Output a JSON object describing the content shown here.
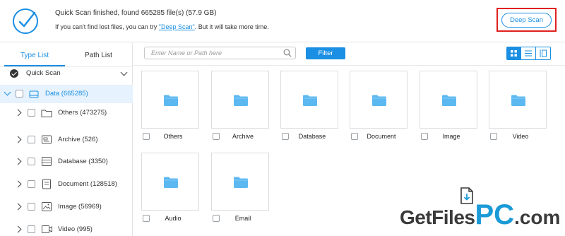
{
  "header": {
    "status_title": "Quick Scan finished, found 665285 file(s) (57.9 GB)",
    "hint_prefix": "If you can't find lost files, you can try ",
    "hint_link": "\"Deep Scan\"",
    "hint_suffix": ". But it will take more time.",
    "deep_scan_label": "Deep Scan"
  },
  "sidebar": {
    "tabs": [
      {
        "label": "Type List",
        "active": true
      },
      {
        "label": "Path List",
        "active": false
      }
    ],
    "quick_scan_label": "Quick Scan",
    "root": {
      "label": "Data (665285)",
      "icon": "drive-icon"
    },
    "items": [
      {
        "label": "Others (473275)",
        "icon": "folder-icon"
      },
      {
        "label": "Archive (526)",
        "icon": "archive-icon"
      },
      {
        "label": "Database (3350)",
        "icon": "database-icon"
      },
      {
        "label": "Document (128518)",
        "icon": "document-icon"
      },
      {
        "label": "Image (56969)",
        "icon": "image-icon"
      },
      {
        "label": "Video (995)",
        "icon": "video-icon"
      }
    ]
  },
  "toolbar": {
    "search_placeholder": "Enter Name or Path here",
    "filter_label": "Filter",
    "view_modes": [
      "grid-view-icon",
      "list-view-icon",
      "preview-view-icon"
    ],
    "active_view": "grid"
  },
  "tiles": [
    {
      "label": "Others"
    },
    {
      "label": "Archive"
    },
    {
      "label": "Database"
    },
    {
      "label": "Document"
    },
    {
      "label": "Image"
    },
    {
      "label": "Video"
    },
    {
      "label": "Audio"
    },
    {
      "label": "Email"
    }
  ],
  "watermark": {
    "part1": "GetFiles",
    "part2": "PC",
    "part3": ".com"
  },
  "colors": {
    "accent": "#1a8fe3",
    "highlight_box": "#e02020",
    "folder": "#5cb8f0"
  }
}
